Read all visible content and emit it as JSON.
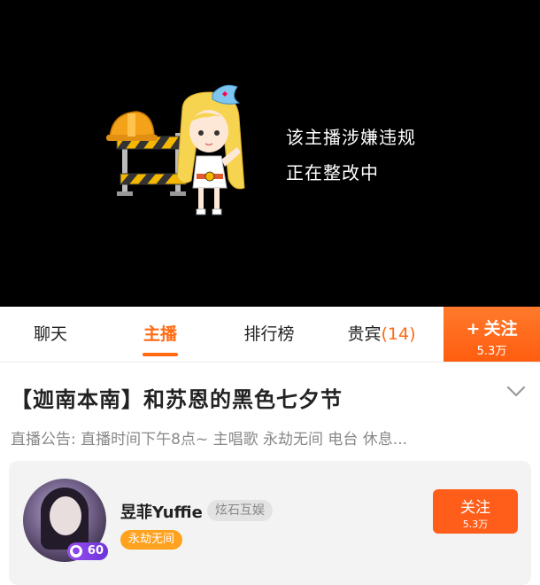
{
  "video": {
    "notice_line1": "该主播涉嫌违规",
    "notice_line2": "正在整改中"
  },
  "tabs": [
    {
      "label": "聊天"
    },
    {
      "label": "主播"
    },
    {
      "label": "排行榜"
    },
    {
      "label": "贵宾",
      "count": "(14)"
    }
  ],
  "follow_tab": {
    "plus": "+",
    "label": "关注",
    "count": "5.3万"
  },
  "room": {
    "title": "【迦南本南】和苏恩的黑色七夕节",
    "announcement": "直播公告: 直播时间下午8点~ 主唱歌 永劫无间 电台 休息..."
  },
  "streamer": {
    "name": "昱菲Yuffie",
    "agency": "炫石互娱",
    "tag": "永劫无间",
    "level": "60",
    "follow_label": "关注",
    "follow_count": "5.3万"
  },
  "colors": {
    "accent": "#ff6a13",
    "tag": "#ffa21f",
    "level": "#8a44ea"
  }
}
